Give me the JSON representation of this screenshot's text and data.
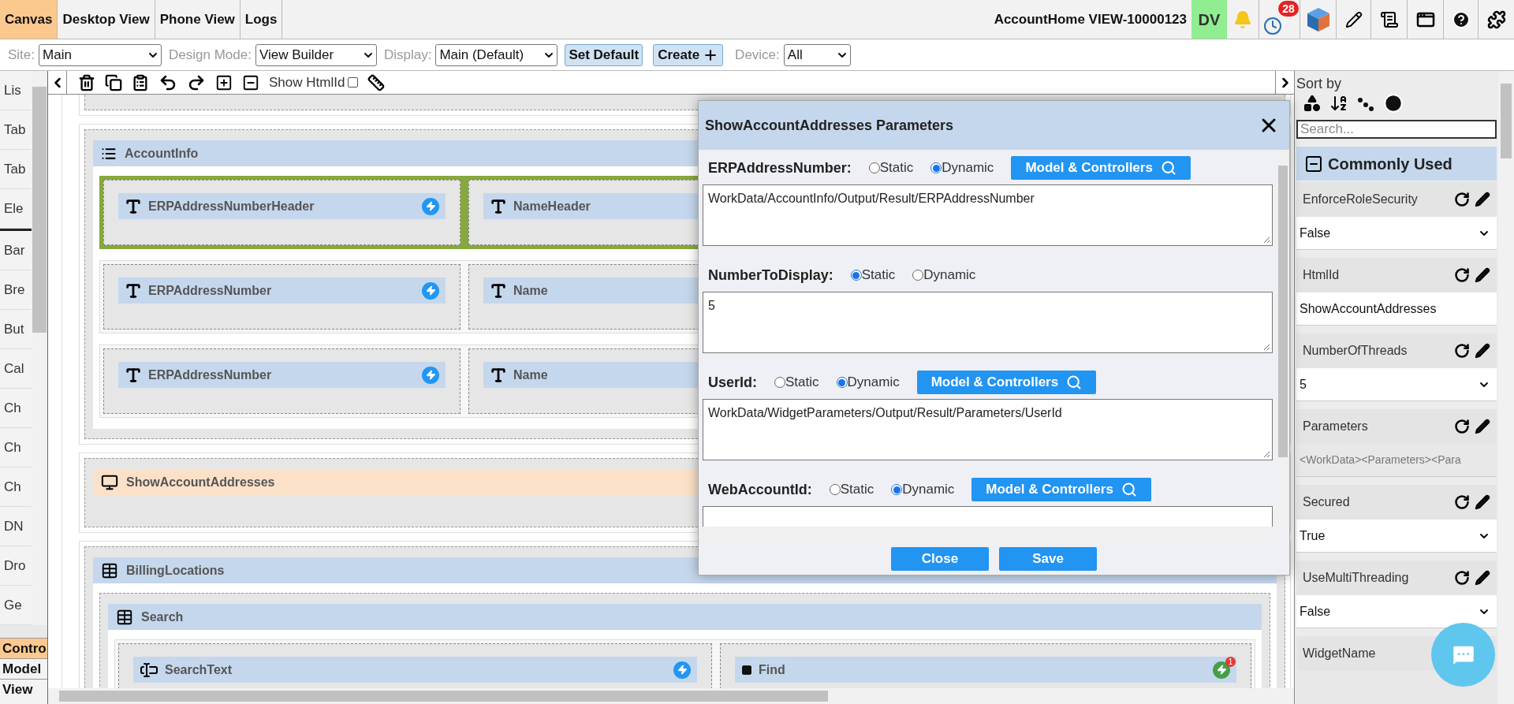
{
  "top_tabs": [
    {
      "label": "Canvas",
      "selected": true
    },
    {
      "label": "Desktop View",
      "selected": false
    },
    {
      "label": "Phone View",
      "selected": false
    },
    {
      "label": "Logs",
      "selected": false
    }
  ],
  "view_title": "AccountHome VIEW-10000123",
  "user_initials": "DV",
  "notification_count": "28",
  "options_bar": [
    {
      "kind": "select",
      "label": "Site:",
      "value": "Main"
    },
    {
      "kind": "select",
      "label": "Design Mode:",
      "value": "View Builder"
    },
    {
      "kind": "select",
      "label": "Display:",
      "value": "Main (Default)"
    },
    {
      "kind": "button",
      "label": "Set Default"
    },
    {
      "kind": "add_button",
      "label": "Create"
    },
    {
      "kind": "select",
      "label": "Device:",
      "value": "All"
    }
  ],
  "toolbar": {
    "show_htmlid": {
      "label": "Show HtmlId",
      "checked": false
    }
  },
  "palette": {
    "groups": [
      [
        "Lis",
        "Tab",
        "Tab",
        "Ele"
      ],
      [
        "Bar",
        "Bre",
        "But",
        "Cal",
        "Ch",
        "Ch",
        "Ch",
        "DN",
        "Dro",
        "Ge"
      ]
    ]
  },
  "bottom_tabs": [
    {
      "label": "Contro",
      "selected": true
    },
    {
      "label": "Model",
      "selected": false
    },
    {
      "label": "View",
      "selected": false
    }
  ],
  "canvas": {
    "widgets": [
      {
        "kind": "list",
        "label": "AccountInfo",
        "selected": false,
        "rows": [
          {
            "selected": true,
            "cells": [
              {
                "kind": "text",
                "label": "ERPAddressNumberHeader",
                "has_event": true
              },
              {
                "kind": "text",
                "label": "NameHeader",
                "has_event": false
              }
            ]
          },
          {
            "selected": false,
            "cells": [
              {
                "kind": "text",
                "label": "ERPAddressNumber",
                "has_event": true
              },
              {
                "kind": "text",
                "label": "Name",
                "has_event": false
              }
            ]
          },
          {
            "selected": false,
            "cells": [
              {
                "kind": "text",
                "label": "ERPAddressNumber",
                "has_event": true
              },
              {
                "kind": "text",
                "label": "Name",
                "has_event": false
              }
            ]
          }
        ]
      },
      {
        "kind": "widget",
        "label": "ShowAccountAddresses",
        "selected": true
      },
      {
        "kind": "table",
        "label": "BillingLocations",
        "selected": false,
        "children": [
          {
            "kind": "table",
            "label": "Search",
            "selected": false,
            "rows": [
              {
                "selected": false,
                "cells": [
                  {
                    "kind": "textbox",
                    "label": "SearchText",
                    "has_event": true
                  },
                  {
                    "kind": "button",
                    "label": "Find",
                    "has_event": true,
                    "event_count": "1"
                  }
                ]
              }
            ]
          }
        ]
      }
    ]
  },
  "dialog": {
    "title": "ShowAccountAddresses Parameters",
    "parameters": [
      {
        "name": "ERPAddressNumber:",
        "modes": [
          {
            "label": "Static",
            "selected": false
          },
          {
            "label": "Dynamic",
            "selected": true
          }
        ],
        "lookup_button": "Model & Controllers",
        "value": "WorkData/AccountInfo/Output/Result/ERPAddressNumber"
      },
      {
        "name": "NumberToDisplay:",
        "modes": [
          {
            "label": "Static",
            "selected": true
          },
          {
            "label": "Dynamic",
            "selected": false
          }
        ],
        "value": "5"
      },
      {
        "name": "UserId:",
        "modes": [
          {
            "label": "Static",
            "selected": false
          },
          {
            "label": "Dynamic",
            "selected": true
          }
        ],
        "lookup_button": "Model & Controllers",
        "value": "WorkData/WidgetParameters/Output/Result/Parameters/UserId"
      },
      {
        "name": "WebAccountId:",
        "modes": [
          {
            "label": "Static",
            "selected": false
          },
          {
            "label": "Dynamic",
            "selected": true
          }
        ],
        "lookup_button": "Model & Controllers"
      }
    ],
    "buttons": [
      "Close",
      "Save"
    ]
  },
  "properties": {
    "sort_label": "Sort by",
    "search": {
      "placeholder": "Search..."
    },
    "group": {
      "title": "Commonly Used",
      "expanded": true
    },
    "items": [
      {
        "name": "EnforceRoleSecurity",
        "kind": "select",
        "value": "False"
      },
      {
        "name": "HtmlId",
        "kind": "text",
        "value": "ShowAccountAddresses"
      },
      {
        "name": "NumberOfThreads",
        "kind": "select",
        "value": "5"
      },
      {
        "name": "Parameters",
        "kind": "readonly",
        "value": "<WorkData><Parameters><Para"
      },
      {
        "name": "Secured",
        "kind": "select",
        "value": "True"
      },
      {
        "name": "UseMultiThreading",
        "kind": "select",
        "value": "False"
      },
      {
        "name": "WidgetName",
        "kind": "lookup"
      }
    ]
  }
}
